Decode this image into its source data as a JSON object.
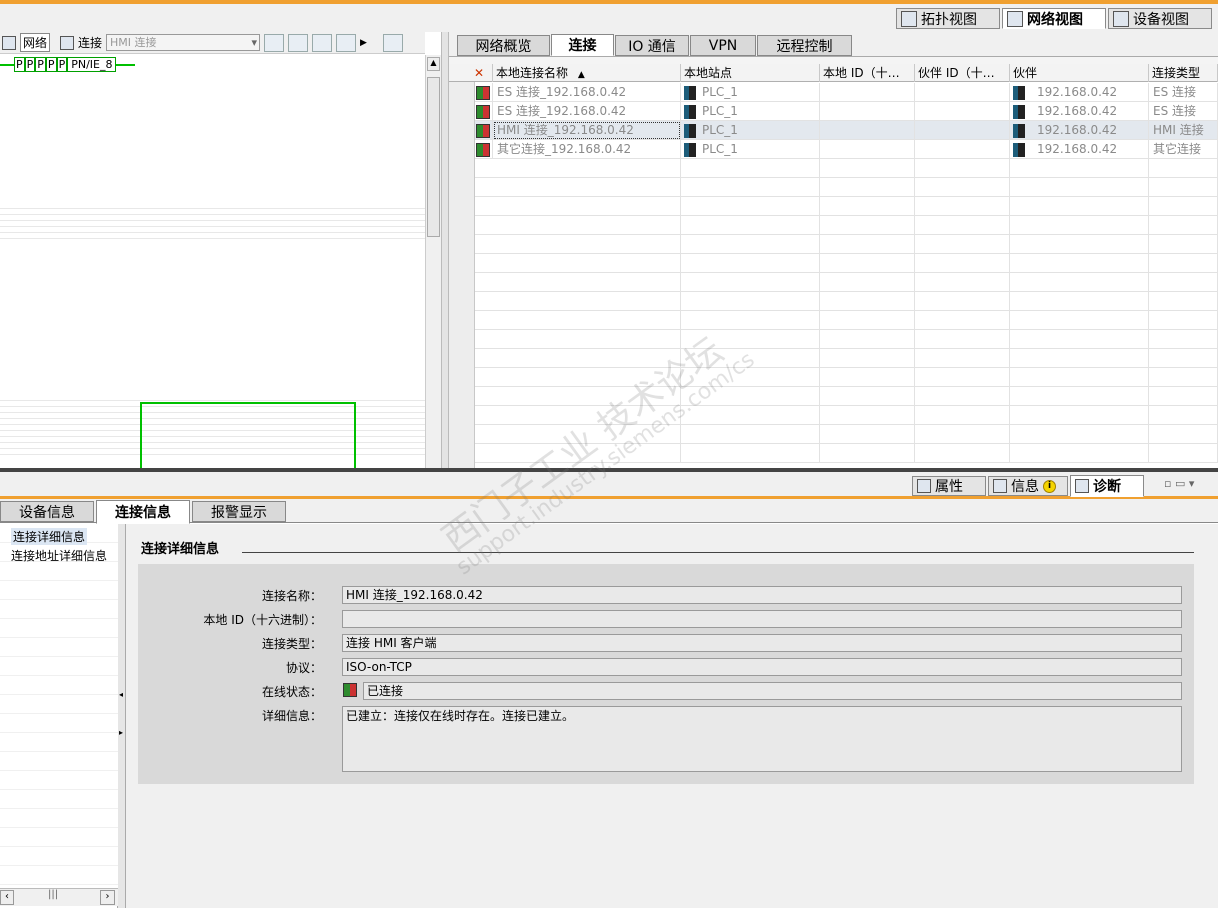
{
  "views": [
    {
      "label": "拓扑视图",
      "active": false
    },
    {
      "label": "网络视图",
      "active": true
    },
    {
      "label": "设备视图",
      "active": false
    }
  ],
  "toolbar": {
    "network_label": "网络",
    "connect_label": "连接",
    "conn_type_value": "HMI 连接"
  },
  "canvas": {
    "port_labels": [
      "P",
      "P",
      "P",
      "P",
      "P"
    ],
    "subnet_label": "PN/IE_8"
  },
  "top_tabs": [
    {
      "label": "网络概览",
      "active": false
    },
    {
      "label": "连接",
      "active": true
    },
    {
      "label": "IO 通信",
      "active": false
    },
    {
      "label": "VPN",
      "active": false
    },
    {
      "label": "远程控制",
      "active": false
    }
  ],
  "connections": {
    "headers": [
      "本地连接名称",
      "本地站点",
      "本地 ID（十…",
      "伙伴 ID（十…",
      "伙伴",
      "连接类型"
    ],
    "sort_indicator": "▲",
    "rows": [
      {
        "name": "ES 连接_192.168.0.42",
        "station": "PLC_1",
        "local_id": "",
        "partner_id": "",
        "partner": "192.168.0.42",
        "type": "ES 连接"
      },
      {
        "name": "ES 连接_192.168.0.42",
        "station": "PLC_1",
        "local_id": "",
        "partner_id": "",
        "partner": "192.168.0.42",
        "type": "ES 连接"
      },
      {
        "name": "HMI 连接_192.168.0.42",
        "station": "PLC_1",
        "local_id": "",
        "partner_id": "",
        "partner": "192.168.0.42",
        "type": "HMI 连接"
      },
      {
        "name": "其它连接_192.168.0.42",
        "station": "PLC_1",
        "local_id": "",
        "partner_id": "",
        "partner": "192.168.0.42",
        "type": "其它连接"
      }
    ]
  },
  "inspector_tabs": {
    "properties": "属性",
    "info": "信息",
    "diagnostics": "诊断"
  },
  "bottom_tabs": [
    {
      "label": "设备信息",
      "active": false
    },
    {
      "label": "连接信息",
      "active": true
    },
    {
      "label": "报警显示",
      "active": false
    }
  ],
  "tree": {
    "items": [
      "连接详细信息",
      "连接地址详细信息"
    ]
  },
  "detail": {
    "title": "连接详细信息"
  },
  "detail_fields": {
    "name_label": "连接名称：",
    "name_value": "HMI 连接_192.168.0.42",
    "local_id_label": "本地 ID（十六进制）：",
    "local_id_value": "",
    "type_label": "连接类型：",
    "type_value": "连接 HMI 客户端",
    "protocol_label": "协议：",
    "protocol_value": "ISO-on-TCP",
    "status_label": "在线状态：",
    "status_value": "已连接",
    "detail_label": "详细信息：",
    "detail_value": "已建立：连接仅在线时存在。连接已建立。"
  },
  "watermark": {
    "line1": "西门子工业 技术论坛",
    "line2": "support.industry.siemens.com/cs"
  }
}
